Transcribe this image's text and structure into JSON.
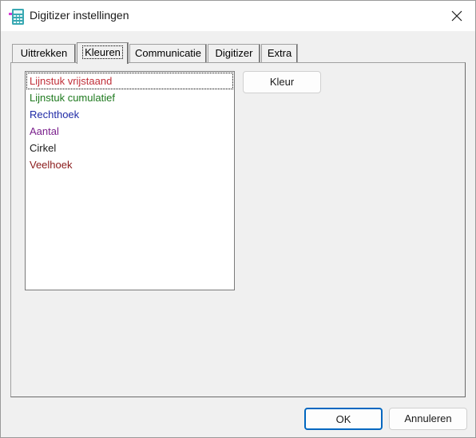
{
  "window": {
    "title": "Digitizer instellingen",
    "icon": "calculator-app-icon",
    "close_icon": "close-icon"
  },
  "tabs": [
    {
      "label": "Uittrekken",
      "active": false
    },
    {
      "label": "Kleuren",
      "active": true
    },
    {
      "label": "Communicatie",
      "active": false
    },
    {
      "label": "Digitizer",
      "active": false
    },
    {
      "label": "Extra",
      "active": false
    }
  ],
  "colors_list": {
    "items": [
      {
        "label": "Lijnstuk vrijstaand",
        "color": "#c0303a",
        "focused": true
      },
      {
        "label": "Lijnstuk cumulatief",
        "color": "#1f7a1f",
        "focused": false
      },
      {
        "label": "Rechthoek",
        "color": "#1f2aa6",
        "focused": false
      },
      {
        "label": "Aantal",
        "color": "#7a1f8c",
        "focused": false
      },
      {
        "label": "Cirkel",
        "color": "#1a1a1a",
        "focused": false
      },
      {
        "label": "Veelhoek",
        "color": "#8a1a1a",
        "focused": false
      }
    ]
  },
  "buttons": {
    "kleur": "Kleur",
    "ok": "OK",
    "cancel": "Annuleren"
  }
}
